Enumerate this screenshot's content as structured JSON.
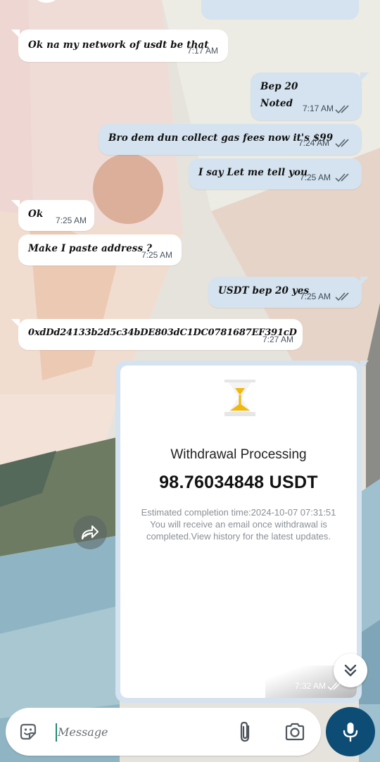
{
  "messages": [
    {
      "dir": "in",
      "text": "Ok na my network of usdt be that",
      "time": "7:17 AM"
    },
    {
      "dir": "out",
      "lines": [
        "Bep 20",
        "Noted"
      ],
      "time": "7:17 AM"
    },
    {
      "dir": "out",
      "text": "Bro dem dun collect gas fees now it's $99",
      "time": "7:24 AM"
    },
    {
      "dir": "out",
      "text": "I say Let me tell you",
      "time": "7:25 AM"
    },
    {
      "dir": "in",
      "text": "Ok",
      "time": "7:25 AM"
    },
    {
      "dir": "in",
      "text": "Make I paste address ?",
      "time": "7:25 AM"
    },
    {
      "dir": "out",
      "text": "USDT bep 20 yes",
      "time": "7:25 AM"
    },
    {
      "dir": "in",
      "text": "0xdDd24133b2d5c34bDE803dC1DC0781687EF391cD",
      "time": "7:27 AM"
    }
  ],
  "image_message": {
    "title": "Withdrawal Processing",
    "amount": "98.76034848 USDT",
    "info_line1": "Estimated completion time:2024-10-07 07:31:51",
    "info_line2": "You will receive an email once withdrawal is",
    "info_line3": "completed.View history for the latest updates.",
    "time": "7:32 AM"
  },
  "input": {
    "placeholder": "Message"
  },
  "icons": {
    "sticker": "sticker-icon",
    "attach": "paperclip-icon",
    "camera": "camera-icon",
    "mic": "microphone-icon",
    "forward": "forward-icon",
    "scroll_down": "double-chevron-down-icon",
    "read_receipt": "double-check-icon"
  },
  "colors": {
    "outgoing_bubble": "#d4e3ef",
    "incoming_bubble": "#ffffff",
    "mic_button": "#0d4c74",
    "hourglass": "#f0b90b"
  }
}
